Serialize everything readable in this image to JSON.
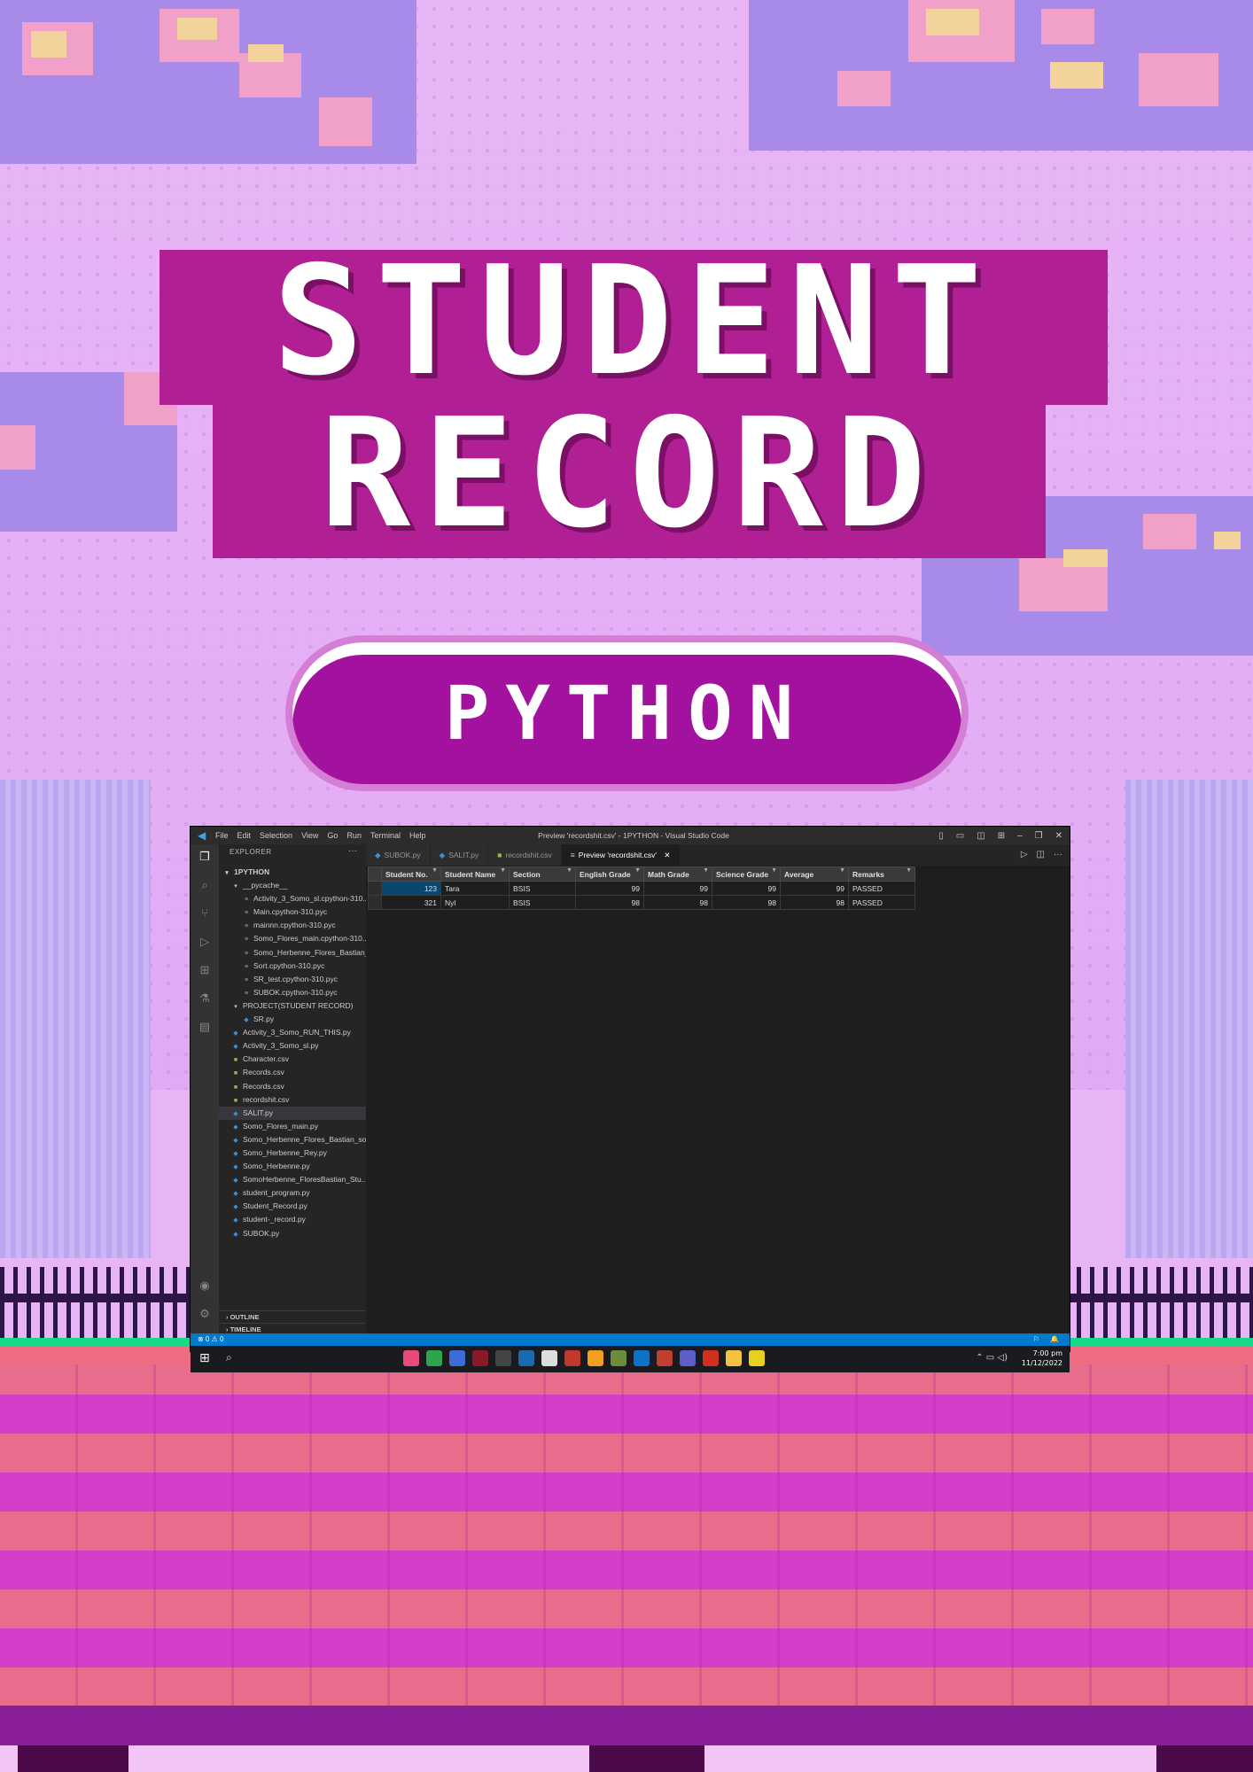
{
  "poster": {
    "title_line1": "STUDENT",
    "title_line2": "RECORD",
    "subtitle": "PYTHON"
  },
  "window": {
    "title": "Preview 'recordshit.csv' - 1PYTHON - Visual Studio Code",
    "menu": [
      "File",
      "Edit",
      "Selection",
      "View",
      "Go",
      "Run",
      "Terminal",
      "Help"
    ]
  },
  "explorer": {
    "header": "EXPLORER",
    "root": "1PYTHON",
    "items": [
      {
        "label": "__pycache__",
        "type": "folder"
      },
      {
        "label": "Activity_3_Somo_sl.cpython-310....",
        "type": "pyc"
      },
      {
        "label": "Main.cpython-310.pyc",
        "type": "pyc"
      },
      {
        "label": "mainnn.cpython-310.pyc",
        "type": "pyc"
      },
      {
        "label": "Somo_Flores_main.cpython-310....",
        "type": "pyc"
      },
      {
        "label": "Somo_Herbenne_Flores_Bastian_s...",
        "type": "pyc"
      },
      {
        "label": "Sort.cpython-310.pyc",
        "type": "pyc"
      },
      {
        "label": "SR_test.cpython-310.pyc",
        "type": "pyc"
      },
      {
        "label": "SUBOK.cpython-310.pyc",
        "type": "pyc"
      },
      {
        "label": "PROJECT(STUDENT RECORD)",
        "type": "folder"
      },
      {
        "label": "SR.py",
        "type": "py"
      },
      {
        "label": "Activity_3_Somo_RUN_THIS.py",
        "type": "py"
      },
      {
        "label": "Activity_3_Somo_sl.py",
        "type": "py"
      },
      {
        "label": "Character.csv",
        "type": "csv"
      },
      {
        "label": "Records.csv",
        "type": "csv"
      },
      {
        "label": "Records.csv",
        "type": "csv"
      },
      {
        "label": "recordshit.csv",
        "type": "csv"
      },
      {
        "label": "SALIT.py",
        "type": "py"
      },
      {
        "label": "Somo_Flores_main.py",
        "type": "py"
      },
      {
        "label": "Somo_Herbenne_Flores_Bastian_so...",
        "type": "py"
      },
      {
        "label": "Somo_Herbenne_Rey.py",
        "type": "py"
      },
      {
        "label": "Somo_Herbenne.py",
        "type": "py"
      },
      {
        "label": "SomoHerbenne_FloresBastian_Stu...",
        "type": "py"
      },
      {
        "label": "student_program.py",
        "type": "py"
      },
      {
        "label": "Student_Record.py",
        "type": "py"
      },
      {
        "label": "student-_record.py",
        "type": "py"
      },
      {
        "label": "SUBOK.py",
        "type": "py"
      }
    ],
    "outline": "OUTLINE",
    "timeline": "TIMELINE"
  },
  "tabs": [
    {
      "label": "SUBOK.py",
      "active": false
    },
    {
      "label": "SALIT.py",
      "active": false
    },
    {
      "label": "recordshit.csv",
      "active": false
    },
    {
      "label": "Preview 'recordshit.csv'",
      "active": true
    }
  ],
  "table": {
    "headers": [
      "Student No.",
      "Student Name",
      "Section",
      "English Grade",
      "Math Grade",
      "Science Grade",
      "Average",
      "Remarks"
    ],
    "rows": [
      [
        "123",
        "Tara",
        "BSIS",
        "99",
        "99",
        "99",
        "99",
        "PASSED"
      ],
      [
        "321",
        "Nyl",
        "BSIS",
        "98",
        "98",
        "98",
        "98",
        "PASSED"
      ]
    ]
  },
  "statusbar": {
    "problems": "⊗ 0 ⚠ 0"
  },
  "taskbar": {
    "time": "7:00 pm",
    "date": "11/12/2022"
  },
  "colors": {
    "accent": "#007acc",
    "title_magenta": "#b01f93",
    "pill": "#a3129f"
  }
}
